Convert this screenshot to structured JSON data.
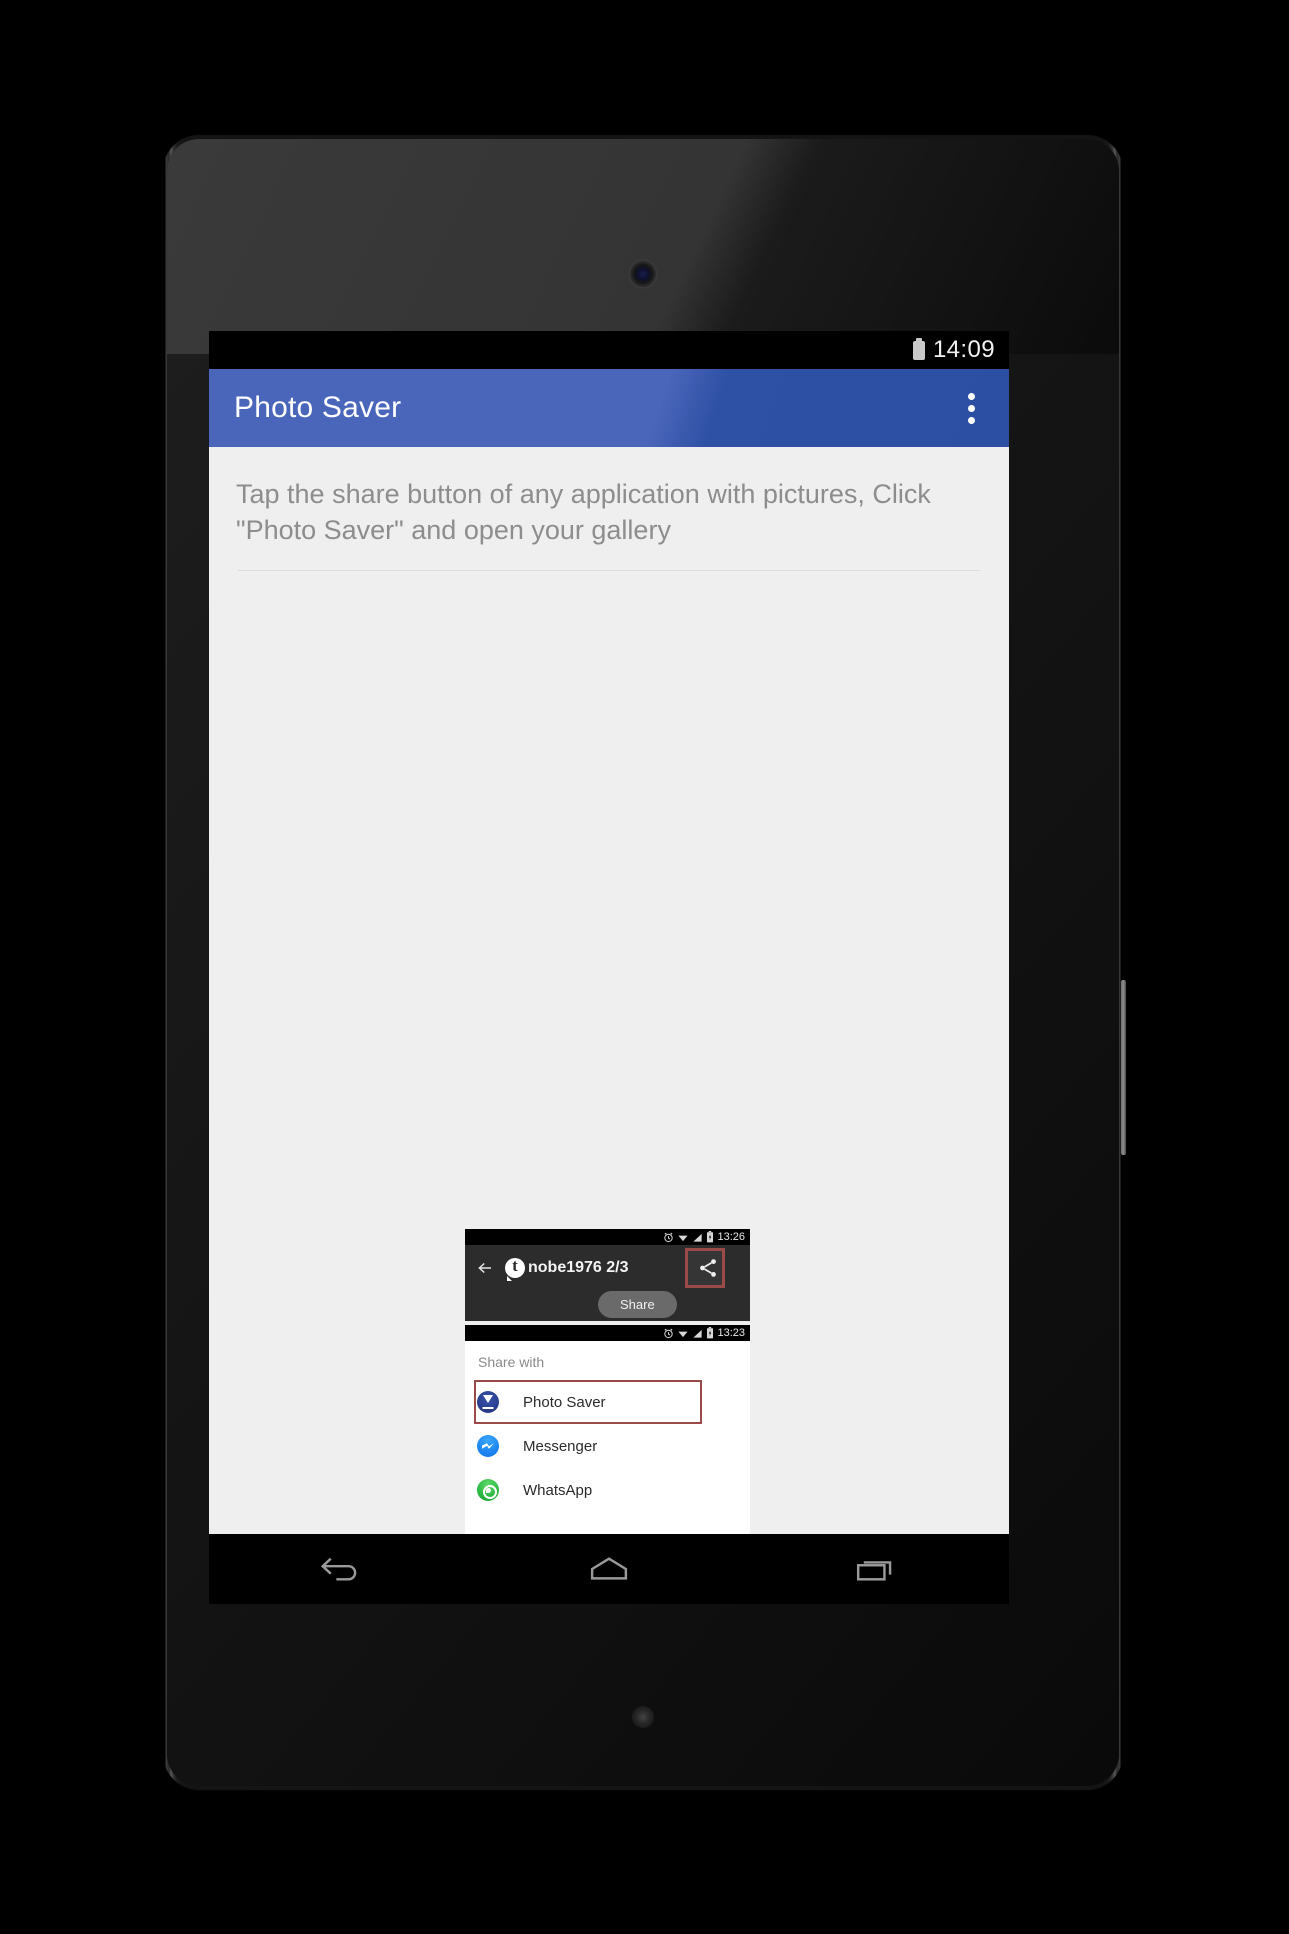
{
  "device": {
    "type": "android-tablet",
    "frame_color": "#141414"
  },
  "status_bar": {
    "time": "14:09",
    "battery_icon": "battery-icon"
  },
  "app_bar": {
    "title": "Photo Saver",
    "background_color": "#4a66bb",
    "overflow_icon": "overflow-menu-icon"
  },
  "main": {
    "instruction": "Tap the share button of any application with pictures, Click \"Photo Saver\" and open your gallery",
    "background_color": "#efefef",
    "text_color": "#8d8d8d"
  },
  "embedded": {
    "shot_one": {
      "status_time": "13:26",
      "status_icons": [
        "alarm-icon",
        "wifi-icon",
        "signal-icon",
        "battery-charging-icon"
      ],
      "back_icon": "back-arrow-icon",
      "avatar_icon": "tumblr-avatar-icon",
      "username": "nobe1976 2/3",
      "share_icon": "share-icon",
      "tooltip": "Share",
      "highlight_color": "#9b4a4a",
      "background_color": "#2c2c2c"
    },
    "shot_two": {
      "status_time": "13:23",
      "status_icons": [
        "alarm-icon",
        "wifi-icon",
        "signal-icon",
        "battery-charging-icon"
      ],
      "title": "Share with",
      "highlight_color": "#9b4a4a",
      "targets": [
        {
          "label": "Photo Saver",
          "icon": "photo-saver-icon",
          "highlighted": true
        },
        {
          "label": "Messenger",
          "icon": "messenger-icon",
          "highlighted": false
        },
        {
          "label": "WhatsApp",
          "icon": "whatsapp-icon",
          "highlighted": false
        }
      ]
    }
  },
  "nav_bar": {
    "back_icon": "back-nav-icon",
    "home_icon": "home-nav-icon",
    "recents_icon": "recents-nav-icon"
  }
}
